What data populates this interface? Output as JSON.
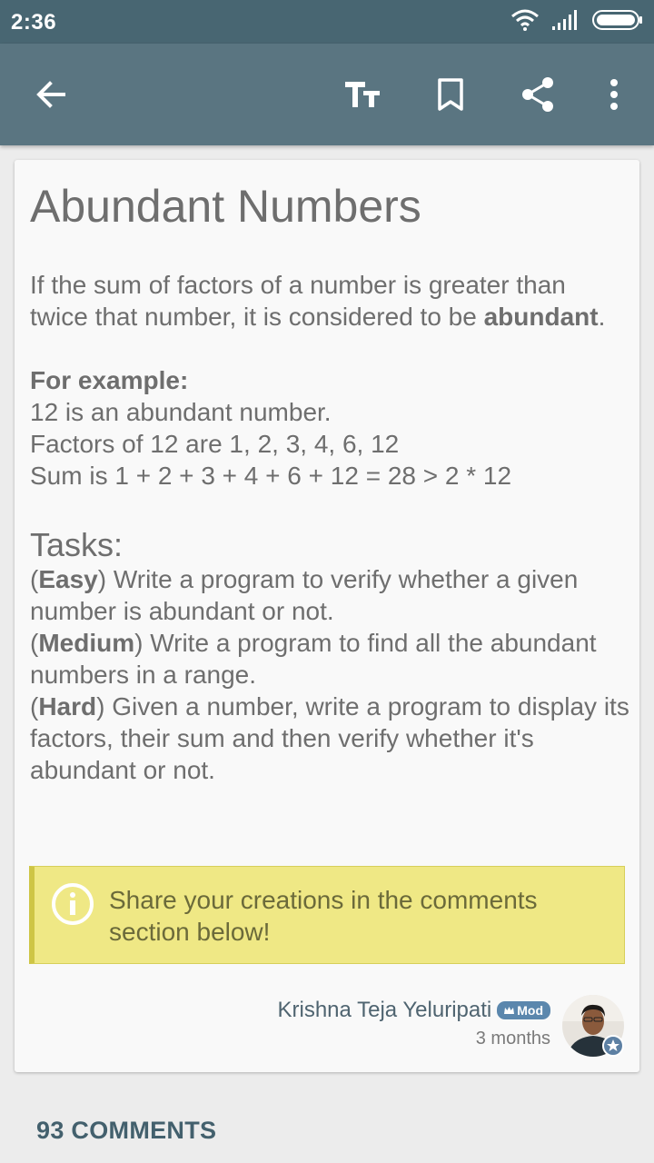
{
  "status_bar": {
    "time": "2:36",
    "icons": [
      "wifi-icon",
      "signal-icon",
      "battery-icon"
    ]
  },
  "toolbar": {
    "icons": [
      "back-arrow-icon",
      "text-size-icon",
      "bookmark-icon",
      "share-icon",
      "more-vert-icon"
    ]
  },
  "post": {
    "title": "Abundant Numbers",
    "intro_1": "If the sum of factors of a number is greater than twice that number, it is considered to be ",
    "intro_bold": "abundant",
    "intro_end": ".",
    "example_heading": "For example:",
    "example_line_1": "12 is an abundant number.",
    "example_line_2": "Factors of 12 are 1, 2, 3, 4, 6, 12",
    "example_line_3": "Sum is 1 + 2 + 3 + 4 + 6 + 12 = 28 > 2 * 12",
    "tasks_heading": "Tasks:",
    "tasks": [
      {
        "level": "Easy",
        "text": " Write a program to verify whether a given number is abundant or not."
      },
      {
        "level": "Medium",
        "text": " Write a program to find all the abundant numbers in a range."
      },
      {
        "level": "Hard",
        "text": " Given a number, write a program to display its factors, their sum and then verify whether it's abundant or not."
      }
    ],
    "callout": "Share your creations in the comments section below!"
  },
  "author": {
    "name": "Krishna Teja Yeluripati",
    "badge": "Mod",
    "time": "3 months"
  },
  "comments_label": "93 COMMENTS",
  "colors": {
    "status_bar": "#486672",
    "toolbar": "#5a7581",
    "callout_bg": "#efe885",
    "badge": "#5b87ad",
    "comments_text": "#43606d"
  }
}
